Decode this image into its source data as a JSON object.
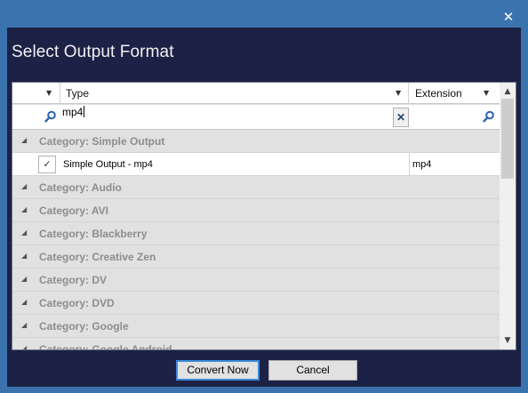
{
  "window": {
    "close_glyph": "✕"
  },
  "dialog": {
    "title": "Select Output Format"
  },
  "grid": {
    "columns": {
      "type": "Type",
      "extension": "Extension"
    },
    "filter": {
      "type_value": "mp4",
      "extension_value": ""
    },
    "rows": [
      {
        "kind": "category",
        "label": "Category:  Simple Output"
      },
      {
        "kind": "item",
        "checked": true,
        "type": "Simple Output - mp4",
        "extension": "mp4"
      },
      {
        "kind": "category",
        "label": "Category: Audio"
      },
      {
        "kind": "category",
        "label": "Category: AVI"
      },
      {
        "kind": "category",
        "label": "Category: Blackberry"
      },
      {
        "kind": "category",
        "label": "Category: Creative Zen"
      },
      {
        "kind": "category",
        "label": "Category: DV"
      },
      {
        "kind": "category",
        "label": "Category: DVD"
      },
      {
        "kind": "category",
        "label": "Category: Google"
      },
      {
        "kind": "category",
        "label": "Category: Google Android"
      }
    ]
  },
  "buttons": {
    "convert": "Convert Now",
    "cancel": "Cancel"
  },
  "colors": {
    "frame": "#3b73ae",
    "client": "#1c2146",
    "grid_bg": "#e1e1e1",
    "accent": "#3c8ad8"
  }
}
